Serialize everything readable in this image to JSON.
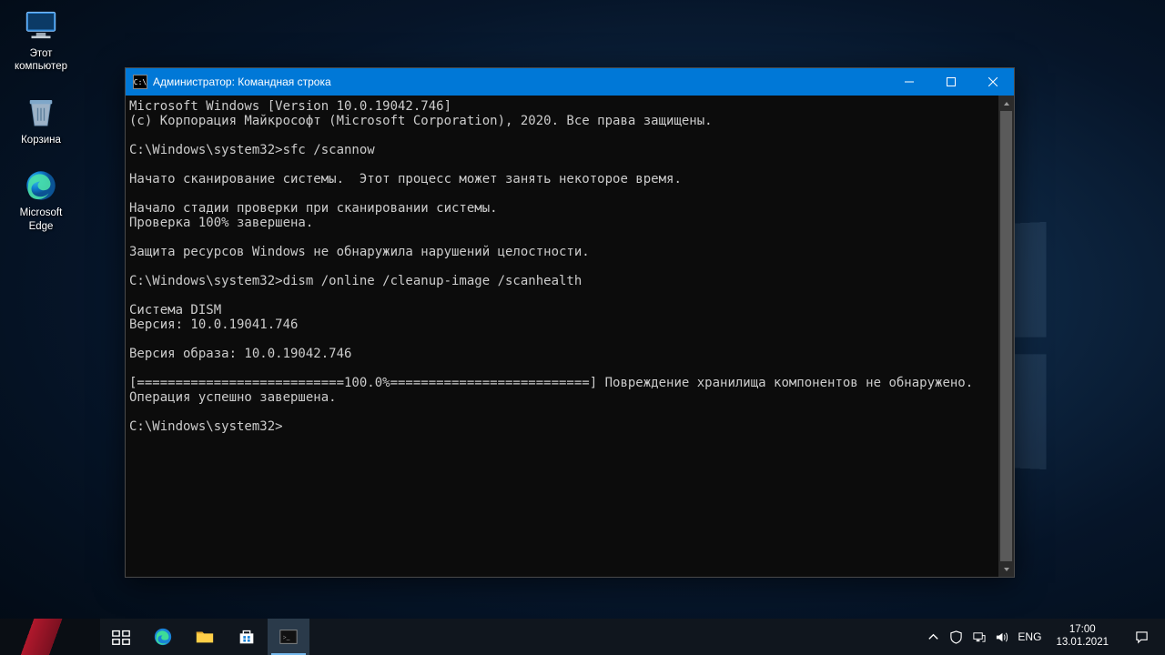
{
  "desktop": {
    "icons": [
      {
        "label": "Этот\nкомпьютер"
      },
      {
        "label": "Корзина"
      },
      {
        "label": "Microsoft\nEdge"
      }
    ]
  },
  "cmd": {
    "title": "Администратор: Командная строка",
    "lines": [
      "Microsoft Windows [Version 10.0.19042.746]",
      "(c) Корпорация Майкрософт (Microsoft Corporation), 2020. Все права защищены.",
      "",
      "C:\\Windows\\system32>sfc /scannow",
      "",
      "Начато сканирование системы.  Этот процесс может занять некоторое время.",
      "",
      "Начало стадии проверки при сканировании системы.",
      "Проверка 100% завершена.",
      "",
      "Защита ресурсов Windows не обнаружила нарушений целостности.",
      "",
      "C:\\Windows\\system32>dism /online /cleanup-image /scanhealth",
      "",
      "Cистема DISM",
      "Версия: 10.0.19041.746",
      "",
      "Версия образа: 10.0.19042.746",
      "",
      "[===========================100.0%==========================] Повреждение хранилища компонентов не обнаружено.",
      "Операция успешно завершена.",
      "",
      "C:\\Windows\\system32>"
    ]
  },
  "taskbar": {
    "lang": "ENG",
    "time": "17:00",
    "date": "13.01.2021"
  }
}
